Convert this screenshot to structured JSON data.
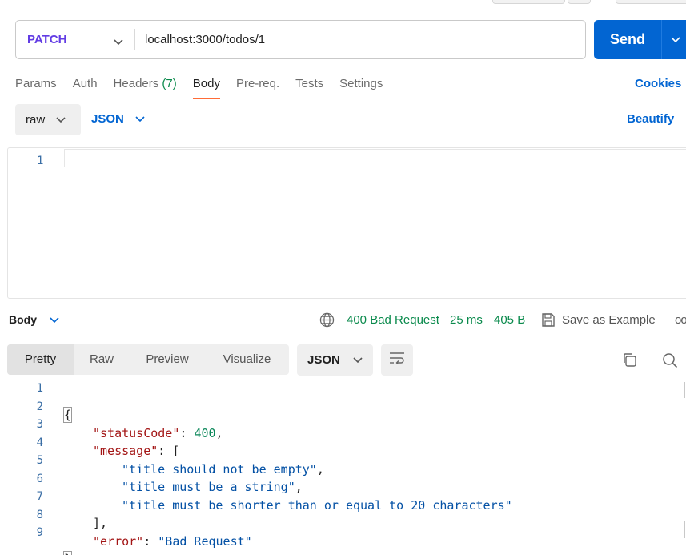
{
  "request": {
    "method": "PATCH",
    "url": "localhost:3000/todos/1",
    "send_label": "Send"
  },
  "request_tabs": [
    {
      "label": "Params",
      "count": "",
      "active": false
    },
    {
      "label": "Auth",
      "count": "",
      "active": false
    },
    {
      "label": "Headers",
      "count": "(7)",
      "active": false
    },
    {
      "label": "Body",
      "count": "",
      "active": true
    },
    {
      "label": "Pre-req.",
      "count": "",
      "active": false
    },
    {
      "label": "Tests",
      "count": "",
      "active": false
    },
    {
      "label": "Settings",
      "count": "",
      "active": false
    }
  ],
  "cookies_label": "Cookies",
  "body_options": {
    "mode": "raw",
    "language": "JSON",
    "beautify_label": "Beautify"
  },
  "request_editor": {
    "line_numbers": [
      "1"
    ]
  },
  "response": {
    "section_label": "Body",
    "status": "400 Bad Request",
    "time": "25 ms",
    "size": "405 B",
    "save_label": "Save as Example",
    "more_label": "ooo",
    "tabs": [
      {
        "label": "Pretty",
        "active": true
      },
      {
        "label": "Raw",
        "active": false
      },
      {
        "label": "Preview",
        "active": false
      },
      {
        "label": "Visualize",
        "active": false
      }
    ],
    "format": "JSON",
    "lines": [
      {
        "n": "1",
        "text": "{"
      },
      {
        "n": "2",
        "key": "\"statusCode\"",
        "sep": ": ",
        "num": "400",
        "end": ","
      },
      {
        "n": "3",
        "key": "\"message\"",
        "sep": ": ",
        "end": "["
      },
      {
        "n": "4",
        "str": "\"title should not be empty\"",
        "end": ","
      },
      {
        "n": "5",
        "str": "\"title must be a string\"",
        "end": ","
      },
      {
        "n": "6",
        "str": "\"title must be shorter than or equal to 20 characters\"",
        "end": ""
      },
      {
        "n": "7",
        "text": "],"
      },
      {
        "n": "8",
        "key": "\"error\"",
        "sep": ": ",
        "str": "\"Bad Request\"",
        "end": ""
      },
      {
        "n": "9",
        "text": "}"
      }
    ]
  },
  "colors": {
    "accent_blue": "#0265d2",
    "method_purple": "#623ce4",
    "status_green": "#0a8a4c",
    "active_tab_underline": "#ff6c37"
  }
}
